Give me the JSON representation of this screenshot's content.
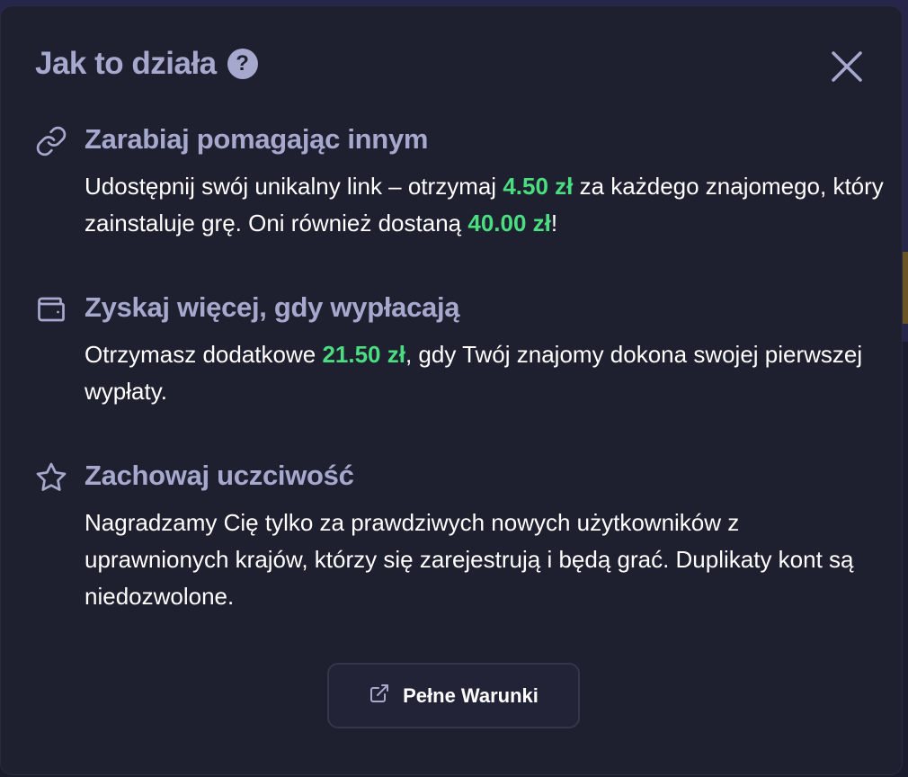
{
  "modal": {
    "title": "Jak to działa",
    "help_glyph": "?",
    "help_icon": "question-circle-icon",
    "close_icon": "close-icon"
  },
  "sections": [
    {
      "icon": "link-icon",
      "title": "Zarabiaj pomagając innym",
      "body": {
        "p1": "Udostępnij swój unikalny link – otrzymaj ",
        "amount1": "4.50 zł",
        "p2": " za każdego znajomego, który zainstaluje grę. Oni również dostaną ",
        "amount2": "40.00 zł",
        "p3": "!"
      }
    },
    {
      "icon": "wallet-icon",
      "title": "Zyskaj więcej, gdy wypłacają",
      "body": {
        "p1": "Otrzymasz dodatkowe ",
        "amount1": "21.50 zł",
        "p2": ", gdy Twój znajomy dokona swojej pierwszej wypłaty."
      }
    },
    {
      "icon": "star-icon",
      "title": "Zachowaj uczciwość",
      "body": {
        "p1": "Nagradzamy Cię tylko za prawdziwych nowych użytkowników z uprawnionych krajów, którzy się zarejestrują i będą grać. Duplikaty kont są niedozwolone."
      }
    }
  ],
  "terms_button": {
    "label": "Pełne Warunki",
    "icon": "external-link-icon"
  },
  "colors": {
    "accent_green": "#4ade80",
    "heading": "#a6a9cd",
    "modal_bg": "#1e1f2f"
  }
}
